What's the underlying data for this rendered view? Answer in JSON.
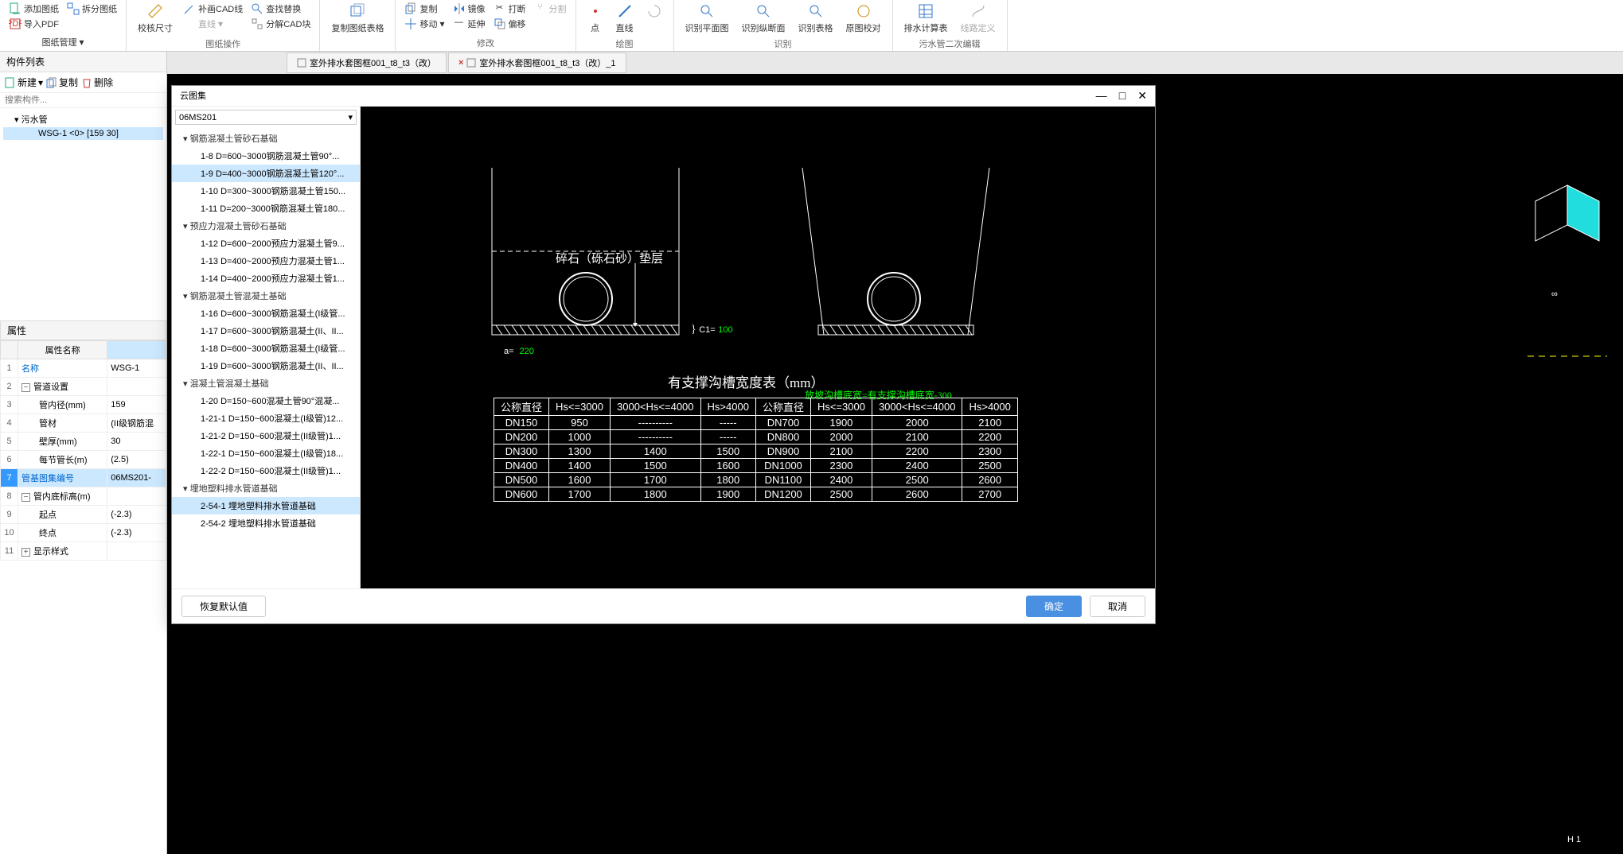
{
  "ribbon": {
    "groups": [
      {
        "title": "图纸管理",
        "items": [
          {
            "id": "add-drawing",
            "label": "添加图纸"
          },
          {
            "id": "split-drawing",
            "label": "拆分图纸"
          },
          {
            "id": "export-pdf",
            "label": "导入PDF"
          }
        ],
        "extra": {
          "id": "drawing-mgmt",
          "label": "图纸管理"
        }
      },
      {
        "title": "图纸操作",
        "items": [
          {
            "id": "check-size",
            "label": "校核尺寸",
            "big": true
          },
          {
            "id": "draw-cad",
            "label": "补画CAD线"
          },
          {
            "id": "line-sub",
            "label": "直线",
            "disabled": true
          },
          {
            "id": "find-replace",
            "label": "查找替换"
          },
          {
            "id": "split-cad",
            "label": "分解CAD块"
          }
        ]
      },
      {
        "title": "",
        "items": [
          {
            "id": "copy-sheet",
            "label": "复制图纸表格",
            "big": true
          }
        ],
        "untitled": true
      },
      {
        "title": "修改",
        "items": [
          {
            "id": "copy",
            "label": "复制"
          },
          {
            "id": "move",
            "label": "移动"
          },
          {
            "id": "mirror",
            "label": "镜像"
          },
          {
            "id": "extend",
            "label": "延伸"
          },
          {
            "id": "break",
            "label": "打断"
          },
          {
            "id": "offset",
            "label": "偏移"
          },
          {
            "id": "split2",
            "label": "分割",
            "disabled": true
          }
        ]
      },
      {
        "title": "绘图",
        "items": [
          {
            "id": "point",
            "label": "点",
            "big": true
          },
          {
            "id": "line",
            "label": "直线",
            "big": true
          },
          {
            "id": "rotate",
            "label": "",
            "big": true,
            "disabled": true
          }
        ]
      },
      {
        "title": "识别",
        "items": [
          {
            "id": "id-plan",
            "label": "识别平面图",
            "big": true
          },
          {
            "id": "id-section",
            "label": "识别纵断面",
            "big": true
          },
          {
            "id": "id-table",
            "label": "识别表格",
            "big": true
          },
          {
            "id": "orig-check",
            "label": "原图校对",
            "big": true
          }
        ]
      },
      {
        "title": "污水管二次编辑",
        "items": [
          {
            "id": "drain-calc",
            "label": "排水计算表",
            "big": true
          },
          {
            "id": "route-def",
            "label": "线路定义",
            "big": true,
            "disabled": true
          }
        ]
      }
    ]
  },
  "tabs": [
    {
      "label": "室外排水套图框001_t8_t3（改）"
    },
    {
      "label": "室外排水套图框001_t8_t3（改）_1"
    }
  ],
  "componentList": {
    "title": "构件列表",
    "toolbar": {
      "new": "新建",
      "copy": "复制",
      "delete": "删除"
    },
    "searchPlaceholder": "搜索构件...",
    "tree": {
      "root": "污水管",
      "leaf": "WSG-1 <0> [159 30]"
    }
  },
  "props": {
    "title": "属性",
    "headers": {
      "name": "属性名称",
      "value": ""
    },
    "rows": [
      {
        "idx": "1",
        "name": "名称",
        "val": "WSG-1",
        "link": true
      },
      {
        "idx": "2",
        "name": "管道设置",
        "val": "",
        "exp": true,
        "link": false
      },
      {
        "idx": "3",
        "name": "管内径(mm)",
        "val": "159",
        "sub": true
      },
      {
        "idx": "4",
        "name": "管材",
        "val": "(II级钢筋混",
        "sub": true
      },
      {
        "idx": "5",
        "name": "壁厚(mm)",
        "val": "30",
        "sub": true
      },
      {
        "idx": "6",
        "name": "每节管长(m)",
        "val": "(2.5)",
        "sub": true
      },
      {
        "idx": "7",
        "name": "管基图集编号",
        "val": "06MS201-",
        "link": true,
        "sel": true
      },
      {
        "idx": "8",
        "name": "管内底标高(m)",
        "val": "",
        "exp": true,
        "link": false
      },
      {
        "idx": "9",
        "name": "起点",
        "val": "(-2.3)",
        "sub": true
      },
      {
        "idx": "10",
        "name": "终点",
        "val": "(-2.3)",
        "sub": true
      },
      {
        "idx": "11",
        "name": "显示样式",
        "val": "",
        "exp": true,
        "expPlus": true,
        "link": false
      }
    ]
  },
  "modal": {
    "title": "云图集",
    "dropdown": "06MS201",
    "footer": {
      "reset": "恢复默认值",
      "ok": "确定",
      "cancel": "取消"
    },
    "tree": [
      {
        "type": "node",
        "label": "钢筋混凝土管砂石基础"
      },
      {
        "type": "leaf",
        "label": "1-8 D=600~3000钢筋混凝土管90°..."
      },
      {
        "type": "leaf",
        "label": "1-9 D=400~3000钢筋混凝土管120°...",
        "sel": true
      },
      {
        "type": "leaf",
        "label": "1-10 D=300~3000钢筋混凝土管150..."
      },
      {
        "type": "leaf",
        "label": "1-11 D=200~3000钢筋混凝土管180..."
      },
      {
        "type": "node",
        "label": "预应力混凝土管砂石基础"
      },
      {
        "type": "leaf",
        "label": "1-12 D=600~2000预应力混凝土管9..."
      },
      {
        "type": "leaf",
        "label": "1-13 D=400~2000预应力混凝土管1..."
      },
      {
        "type": "leaf",
        "label": "1-14 D=400~2000预应力混凝土管1..."
      },
      {
        "type": "node",
        "label": "钢筋混凝土管混凝土基础"
      },
      {
        "type": "leaf",
        "label": "1-16 D=600~3000钢筋混凝土(I级管..."
      },
      {
        "type": "leaf",
        "label": "1-17 D=600~3000钢筋混凝土(II、II..."
      },
      {
        "type": "leaf",
        "label": "1-18 D=600~3000钢筋混凝土(I级管..."
      },
      {
        "type": "leaf",
        "label": "1-19 D=600~3000钢筋混凝土(II、II..."
      },
      {
        "type": "node",
        "label": "混凝土管混凝土基础"
      },
      {
        "type": "leaf",
        "label": "1-20 D=150~600混凝土管90°混凝..."
      },
      {
        "type": "leaf",
        "label": "1-21-1 D=150~600混凝土(I级管)12..."
      },
      {
        "type": "leaf",
        "label": "1-21-2 D=150~600混凝土(II级管)1..."
      },
      {
        "type": "leaf",
        "label": "1-22-1 D=150~600混凝土(I级管)18..."
      },
      {
        "type": "leaf",
        "label": "1-22-2 D=150~600混凝土(II级管)1..."
      },
      {
        "type": "node",
        "label": "埋地塑料排水管道基础"
      },
      {
        "type": "leaf",
        "label": "2-54-1 埋地塑料排水管道基础",
        "sel": true
      },
      {
        "type": "leaf",
        "label": "2-54-2 埋地塑料排水管道基础"
      }
    ]
  },
  "canvas": {
    "bedding_label": "碎石（砾石砂）垫层",
    "c1_label": "C1=",
    "c1_val": "100",
    "a_label": "a=",
    "a_val": "220",
    "table_title": "有支撑沟槽宽度表（mm）",
    "table_note": "放坡沟槽底宽=有支撑沟槽底宽-300"
  },
  "chart_data": {
    "type": "table",
    "title": "有支撑沟槽宽度表（mm）",
    "headers": [
      "公称直径",
      "Hs<=3000",
      "3000<Hs<=4000",
      "Hs>4000",
      "公称直径",
      "Hs<=3000",
      "3000<Hs<=4000",
      "Hs>4000"
    ],
    "rows": [
      [
        "DN150",
        "950",
        "----------",
        "-----",
        "DN700",
        "1900",
        "2000",
        "2100"
      ],
      [
        "DN200",
        "1000",
        "----------",
        "-----",
        "DN800",
        "2000",
        "2100",
        "2200"
      ],
      [
        "DN300",
        "1300",
        "1400",
        "1500",
        "DN900",
        "2100",
        "2200",
        "2300"
      ],
      [
        "DN400",
        "1400",
        "1500",
        "1600",
        "DN1000",
        "2300",
        "2400",
        "2500"
      ],
      [
        "DN500",
        "1600",
        "1700",
        "1800",
        "DN1100",
        "2400",
        "2500",
        "2600"
      ],
      [
        "DN600",
        "1700",
        "1800",
        "1900",
        "DN1200",
        "2500",
        "2600",
        "2700"
      ]
    ]
  }
}
